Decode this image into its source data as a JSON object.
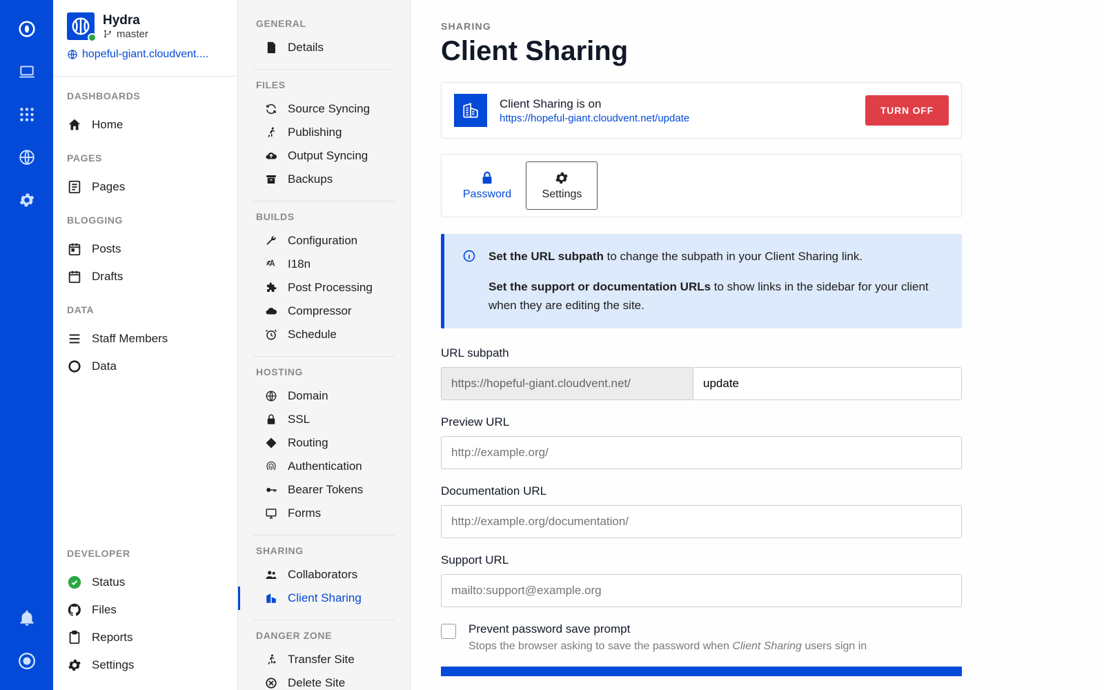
{
  "site": {
    "name": "Hydra",
    "branch": "master",
    "url": "hopeful-giant.cloudvent...."
  },
  "side1": {
    "dashboards": {
      "label": "DASHBOARDS",
      "items": [
        {
          "label": "Home"
        }
      ]
    },
    "pages": {
      "label": "PAGES",
      "items": [
        {
          "label": "Pages"
        }
      ]
    },
    "blogging": {
      "label": "BLOGGING",
      "items": [
        {
          "label": "Posts"
        },
        {
          "label": "Drafts"
        }
      ]
    },
    "data": {
      "label": "DATA",
      "items": [
        {
          "label": "Staff Members"
        },
        {
          "label": "Data"
        }
      ]
    },
    "developer": {
      "label": "DEVELOPER",
      "items": [
        {
          "label": "Status"
        },
        {
          "label": "Files"
        },
        {
          "label": "Reports"
        },
        {
          "label": "Settings"
        }
      ]
    }
  },
  "side2": {
    "general": {
      "label": "GENERAL",
      "items": [
        {
          "label": "Details"
        }
      ]
    },
    "files": {
      "label": "FILES",
      "items": [
        {
          "label": "Source Syncing"
        },
        {
          "label": "Publishing"
        },
        {
          "label": "Output Syncing"
        },
        {
          "label": "Backups"
        }
      ]
    },
    "builds": {
      "label": "BUILDS",
      "items": [
        {
          "label": "Configuration"
        },
        {
          "label": "I18n"
        },
        {
          "label": "Post Processing"
        },
        {
          "label": "Compressor"
        },
        {
          "label": "Schedule"
        }
      ]
    },
    "hosting": {
      "label": "HOSTING",
      "items": [
        {
          "label": "Domain"
        },
        {
          "label": "SSL"
        },
        {
          "label": "Routing"
        },
        {
          "label": "Authentication"
        },
        {
          "label": "Bearer Tokens"
        },
        {
          "label": "Forms"
        }
      ]
    },
    "sharing": {
      "label": "SHARING",
      "items": [
        {
          "label": "Collaborators"
        },
        {
          "label": "Client Sharing"
        }
      ]
    },
    "danger": {
      "label": "DANGER ZONE",
      "items": [
        {
          "label": "Transfer Site"
        },
        {
          "label": "Delete Site"
        }
      ]
    }
  },
  "main": {
    "eyebrow": "SHARING",
    "title": "Client Sharing",
    "status": {
      "line1": "Client Sharing is on",
      "line2": "https://hopeful-giant.cloudvent.net/update",
      "button": "TURN OFF"
    },
    "tabs": {
      "password": "Password",
      "settings": "Settings"
    },
    "info": {
      "p1b": "Set the URL subpath",
      "p1": " to change the subpath in your Client Sharing link.",
      "p2b": "Set the support or documentation URLs",
      "p2": " to show links in the sidebar for your client when they are editing the site."
    },
    "fields": {
      "url_subpath": {
        "label": "URL subpath",
        "prefix": "https://hopeful-giant.cloudvent.net/",
        "value": "update"
      },
      "preview": {
        "label": "Preview URL",
        "placeholder": "http://example.org/"
      },
      "docs": {
        "label": "Documentation URL",
        "placeholder": "http://example.org/documentation/"
      },
      "support": {
        "label": "Support URL",
        "placeholder": "mailto:support@example.org"
      },
      "prevent": {
        "label": "Prevent password save prompt",
        "help_a": "Stops the browser asking to save the password when ",
        "help_i": "Client Sharing",
        "help_b": " users sign in"
      }
    }
  }
}
